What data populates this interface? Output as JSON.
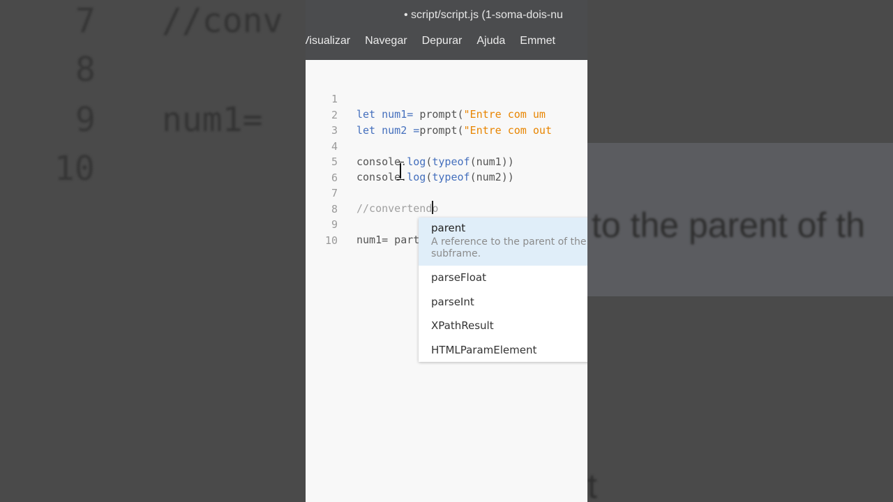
{
  "window": {
    "title": "• script/script.js (1-soma-dois-nu"
  },
  "menu": [
    "Visualizar",
    "Navegar",
    "Depurar",
    "Ajuda",
    "Emmet"
  ],
  "code": {
    "line_numbers": [
      "1",
      "2",
      "3",
      "4",
      "5",
      "6",
      "7",
      "8",
      "9",
      "10"
    ],
    "line1": {
      "kw1": "let",
      "var": " num1= ",
      "fn": "prompt",
      "open": "(",
      "str": "\"Entre com um"
    },
    "line2": {
      "kw1": "let",
      "var": " num2 =",
      "fn": "prompt",
      "open": "(",
      "str": "\"Entre com out"
    },
    "line4": {
      "obj": "console.",
      "method": "log",
      "open": "(",
      "kw": "typeof",
      "rest": "(num1))"
    },
    "line5": {
      "obj": "console.",
      "method": "log",
      "open": "(",
      "kw": "typeof",
      "rest": "(num2))"
    },
    "line7": {
      "comment": "//convertendo"
    },
    "line9": {
      "text": "num1= part"
    }
  },
  "hints": {
    "selected_name": "parent",
    "selected_desc": "A reference to the parent of the subframe.",
    "items": [
      "parseFloat",
      "parseInt",
      "XPathResult",
      "HTMLParamElement"
    ]
  },
  "background": {
    "left_lines": [
      {
        "num": "7",
        "code": "//conv"
      },
      {
        "num": "8",
        "code": ""
      },
      {
        "num": "9",
        "code": "num1= "
      },
      {
        "num": "10",
        "code": ""
      }
    ],
    "right_text": "to the parent of th",
    "right_text2": "t"
  },
  "colors": {
    "keyword": "#446fbd",
    "string": "#e88501",
    "comment": "#a0a0a0",
    "titlebar": "#4b4c4e",
    "hint_selected": "#e0eef9"
  }
}
